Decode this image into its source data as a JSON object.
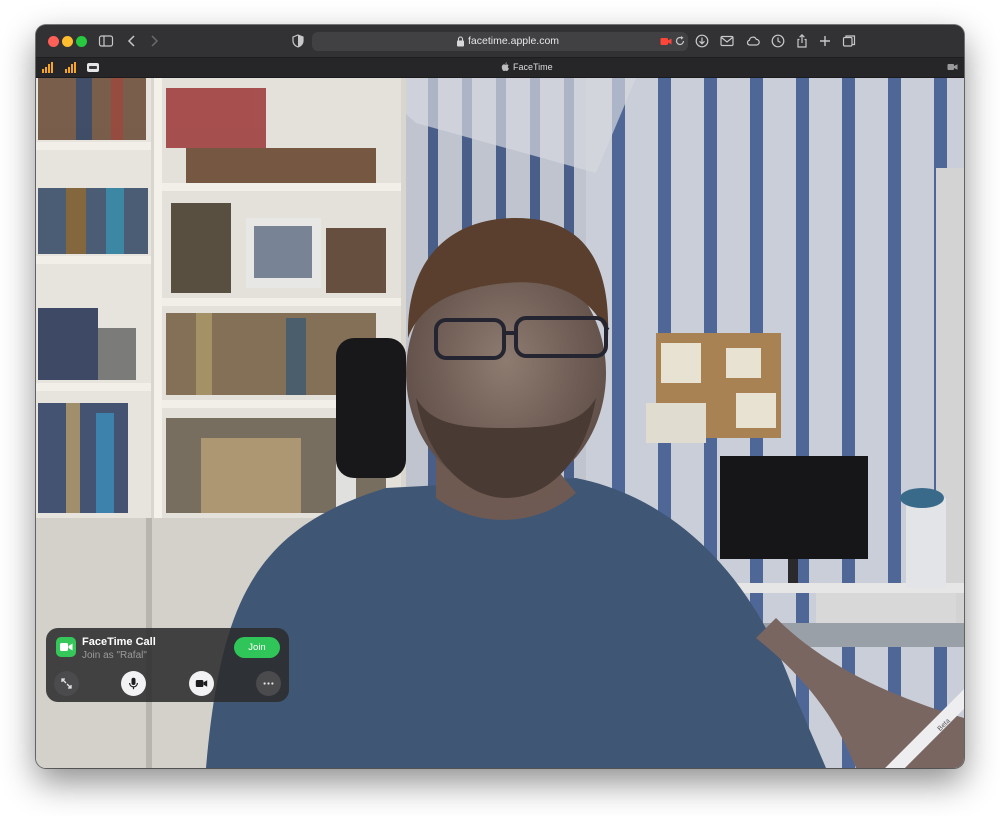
{
  "browser": {
    "url": "facetime.apple.com",
    "tab_title": "FaceTime",
    "toolbar_icons": [
      "sidebar-icon",
      "back-icon",
      "forward-icon",
      "shield-icon",
      "download-icon",
      "mail-icon",
      "cloud-icon",
      "history-icon",
      "share-icon",
      "new-tab-icon",
      "tab-overview-icon"
    ]
  },
  "call_panel": {
    "title": "FaceTime Call",
    "subtitle": "Join as \"Rafal\"",
    "join_label": "Join",
    "controls": [
      "expand-icon",
      "microphone-icon",
      "video-camera-icon",
      "more-icon"
    ]
  },
  "ribbon": {
    "label": "Beta"
  },
  "colors": {
    "join_green": "#30c559",
    "facetime_green": "#35c759",
    "close_red": "#fe5f57",
    "minimize_yellow": "#febc2e",
    "maximize_green": "#28c840"
  }
}
